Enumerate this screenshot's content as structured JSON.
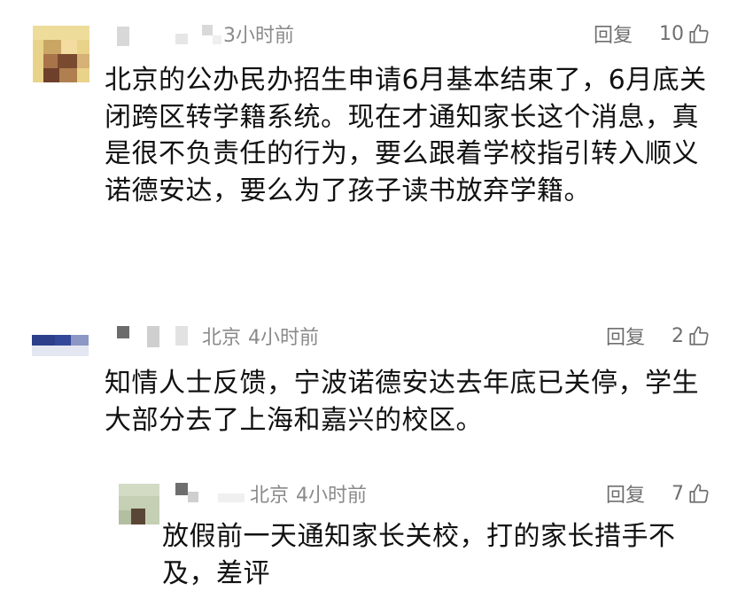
{
  "comments": [
    {
      "location": "",
      "time": "3小时前",
      "reply_label": "回复",
      "likes": "10",
      "text": "北京的公办民办招生申请6月基本结束了，6月底关闭跨区转学籍系统。现在才通知家长这个消息，真是很不负责任的行为，要么跟着学校指引转入顺义诺德安达，要么为了孩子读书放弃学籍。",
      "avatar_icon": "pixelated-avatar"
    },
    {
      "location": "北京",
      "time": "4小时前",
      "reply_label": "回复",
      "likes": "2",
      "text": "知情人士反馈，宁波诺德安达去年底已关停，学生大部分去了上海和嘉兴的校区。",
      "avatar_icon": "pixelated-avatar"
    },
    {
      "location": "北京",
      "time": "4小时前",
      "reply_label": "回复",
      "likes": "7",
      "text": "放假前一天通知家长关校，打的家长措手不及，差评",
      "avatar_icon": "pixelated-avatar"
    }
  ],
  "colors": {
    "text": "#111111",
    "meta": "#8a8a8a",
    "action": "#6f6f6f"
  },
  "icons": {
    "like": "thumbs-up-icon"
  }
}
